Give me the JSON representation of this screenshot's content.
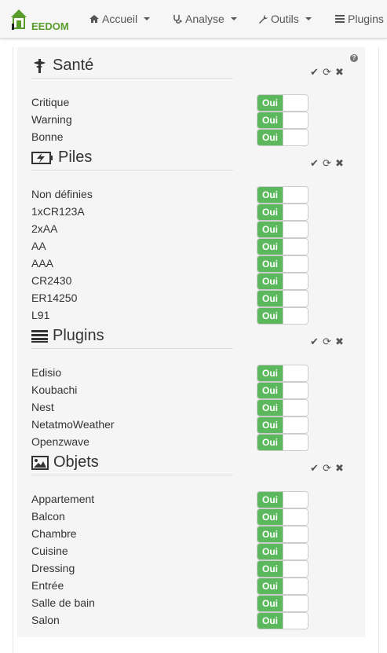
{
  "navbar": {
    "logo_text_prefix": "J",
    "logo_text": "EEDOM",
    "items": [
      {
        "label": "Accueil",
        "icon": "home-icon"
      },
      {
        "label": "Analyse",
        "icon": "stethoscope-icon"
      },
      {
        "label": "Outils",
        "icon": "wrench-icon"
      },
      {
        "label": "Plugins",
        "icon": "list-icon"
      }
    ]
  },
  "help": "?",
  "toggle_on_label": "Oui",
  "colors": {
    "toggle_on": "#5cb85c",
    "logo_green": "#5a9c2c"
  },
  "sections": [
    {
      "title": "Santé",
      "icon": "medical-icon",
      "rows": [
        "Critique",
        "Warning",
        "Bonne"
      ]
    },
    {
      "title": "Piles",
      "icon": "battery-icon",
      "rows": [
        "Non définies",
        "1xCR123A",
        "2xAA",
        "AA",
        "AAA",
        "CR2430",
        "ER14250",
        "L91"
      ]
    },
    {
      "title": "Plugins",
      "icon": "list-icon",
      "rows": [
        "Edisio",
        "Koubachi",
        "Nest",
        "NetatmoWeather",
        "Openzwave"
      ]
    },
    {
      "title": "Objets",
      "icon": "picture-icon",
      "rows": [
        "Appartement",
        "Balcon",
        "Chambre",
        "Cuisine",
        "Dressing",
        "Entrée",
        "Salle de bain",
        "Salon"
      ]
    }
  ]
}
